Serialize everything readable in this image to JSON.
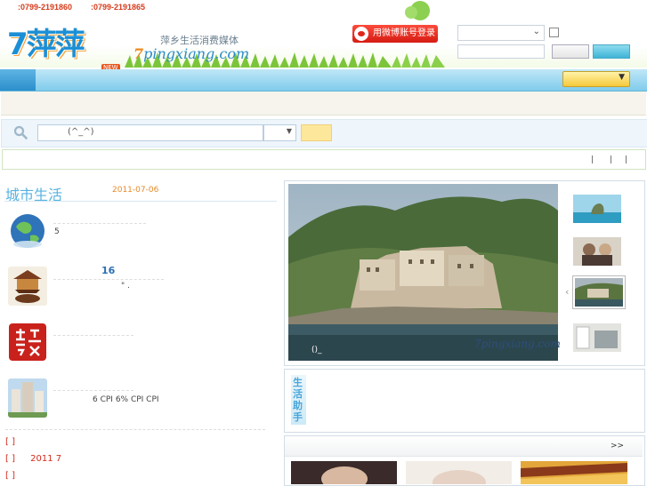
{
  "topbar": {
    "phone1": ":0799-2191860",
    "phone2": ":0799-2191865"
  },
  "header": {
    "logo_text": "7萍萍",
    "logo_badge": "NEW",
    "slogan": "萍乡生活消费媒体",
    "url_prefix": "7",
    "url_main": "pingxiang.com"
  },
  "login": {
    "weibo_label": "用微博账号登录",
    "select_value": "",
    "password_value": ""
  },
  "search": {
    "placeholder": "(^_^)",
    "scope_value": ""
  },
  "city_life": {
    "title": "城市生活",
    "date": "2011-07-06",
    "items": [
      {
        "text": "5",
        "icon": "earth-icon"
      },
      {
        "num": "16",
        "text": "\"   .",
        "icon": "teahouse-icon"
      },
      {
        "text": "",
        "icon": "shepin-seal-icon"
      },
      {
        "text": "6 CPI    6%     CPI      CPI",
        "icon": "buildings-icon"
      }
    ],
    "bracket_items": [
      {
        "b": "[   ]",
        "text": ""
      },
      {
        "b": "[   ]",
        "text": "2011 7"
      },
      {
        "b": "[   ]",
        "text": ""
      }
    ]
  },
  "slider": {
    "caption": "()_",
    "watermark": "7pingxiang.com",
    "thumbs": [
      "rock-island",
      "couple-photo",
      "monastery",
      "balcony"
    ]
  },
  "helper": {
    "label": "生活助手"
  },
  "more": {
    "link": ">>"
  },
  "colors": {
    "accent_blue": "#57b3e0",
    "nav_blue": "#80ccec",
    "brand_red": "#d63a1a",
    "date_orange": "#e68a2a"
  }
}
